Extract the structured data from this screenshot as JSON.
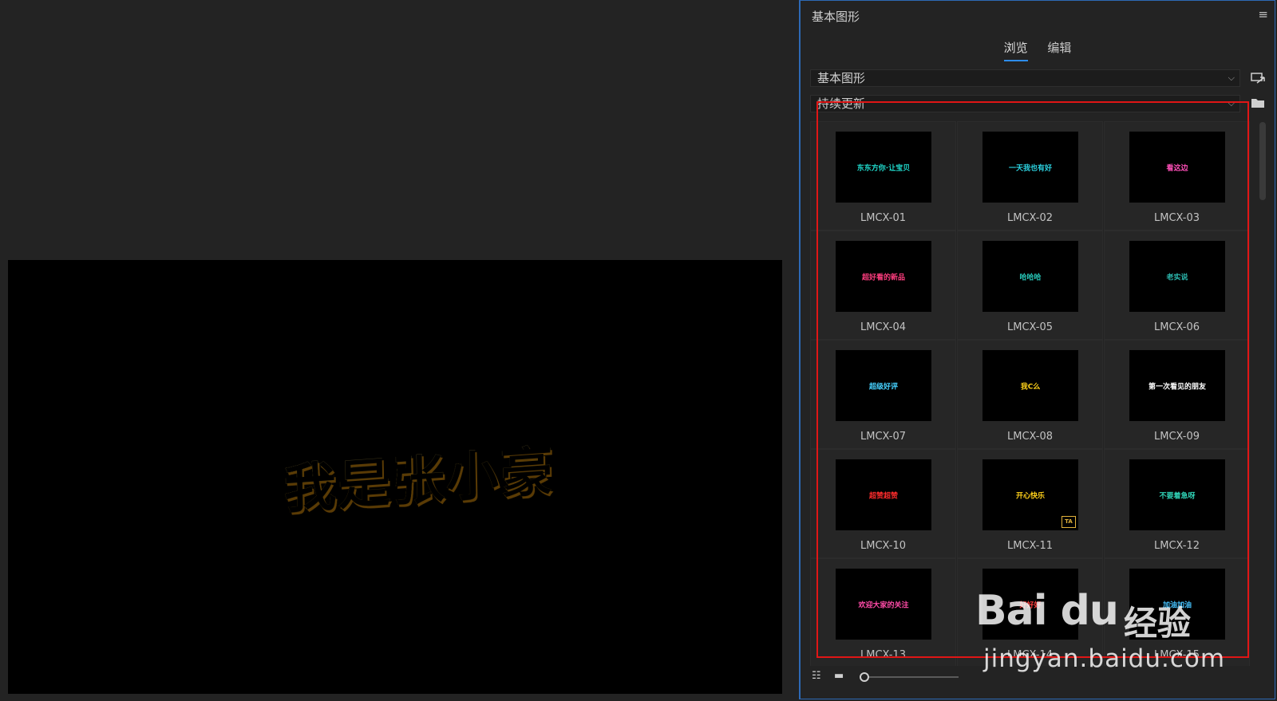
{
  "preview": {
    "title": "我是张小豪"
  },
  "panel": {
    "title": "基本图形",
    "tabs": [
      {
        "label": "浏览",
        "active": true
      },
      {
        "label": "编辑",
        "active": false
      }
    ],
    "library_dropdown": "基本图形",
    "folder_dropdown": "持续更新"
  },
  "templates": [
    {
      "label": "LMCX-01",
      "thumb_text": "东东方你·让宝贝",
      "thumb_color": "#1fd6c9"
    },
    {
      "label": "LMCX-02",
      "thumb_text": "一天我也有好",
      "thumb_color": "#2cd2e0"
    },
    {
      "label": "LMCX-03",
      "thumb_text": "看这边",
      "thumb_color": "#ff4fb8"
    },
    {
      "label": "LMCX-04",
      "thumb_text": "超好看的新品",
      "thumb_color": "#ff3d7f"
    },
    {
      "label": "LMCX-05",
      "thumb_text": "哈哈哈",
      "thumb_color": "#27c7b8"
    },
    {
      "label": "LMCX-06",
      "thumb_text": "老实说",
      "thumb_color": "#2bb6ac"
    },
    {
      "label": "LMCX-07",
      "thumb_text": "超级好评",
      "thumb_color": "#46d1ff"
    },
    {
      "label": "LMCX-08",
      "thumb_text": "我C么",
      "thumb_color": "#ffd21a"
    },
    {
      "label": "LMCX-09",
      "thumb_text": "第一次看见的朋友",
      "thumb_color": "#ffffff"
    },
    {
      "label": "LMCX-10",
      "thumb_text": "超赞超赞",
      "thumb_color": "#ff2c2c"
    },
    {
      "label": "LMCX-11",
      "thumb_text": "开心快乐",
      "thumb_color": "#ffd11a",
      "badge": "TA"
    },
    {
      "label": "LMCX-12",
      "thumb_text": "不要着急呀",
      "thumb_color": "#2fd0b4"
    },
    {
      "label": "LMCX-13",
      "thumb_text": "欢迎大家的关注",
      "thumb_color": "#ff4ba8"
    },
    {
      "label": "LMCX-14",
      "thumb_text": "好好好",
      "thumb_color": "#ff3d3d"
    },
    {
      "label": "LMCX-15",
      "thumb_text": "加油加油",
      "thumb_color": "#46c3ff"
    }
  ],
  "watermark": {
    "logo": "Bai du",
    "cn": "经验",
    "url": "jingyan.baidu.com"
  }
}
